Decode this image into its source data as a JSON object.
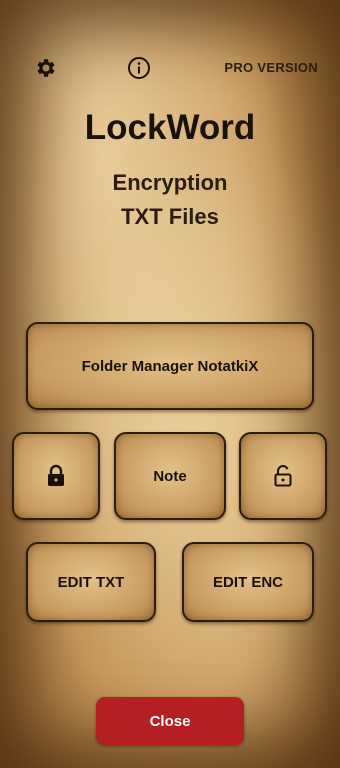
{
  "header": {
    "settings_icon": "gear-icon",
    "info_icon": "info-icon",
    "pro_label": "PRO VERSION"
  },
  "app": {
    "title": "LockWord",
    "subtitle_line1": "Encryption",
    "subtitle_line2": "TXT Files"
  },
  "buttons": {
    "folder_manager": "Folder Manager NotatkiX",
    "lock_icon": "lock-closed-icon",
    "note": "Note",
    "unlock_icon": "lock-open-icon",
    "edit_txt": "EDIT TXT",
    "edit_enc": "EDIT ENC",
    "close": "Close"
  },
  "colors": {
    "close_button": "#b51f22",
    "text": "#1a1208",
    "parchment": "#d9b77e"
  }
}
